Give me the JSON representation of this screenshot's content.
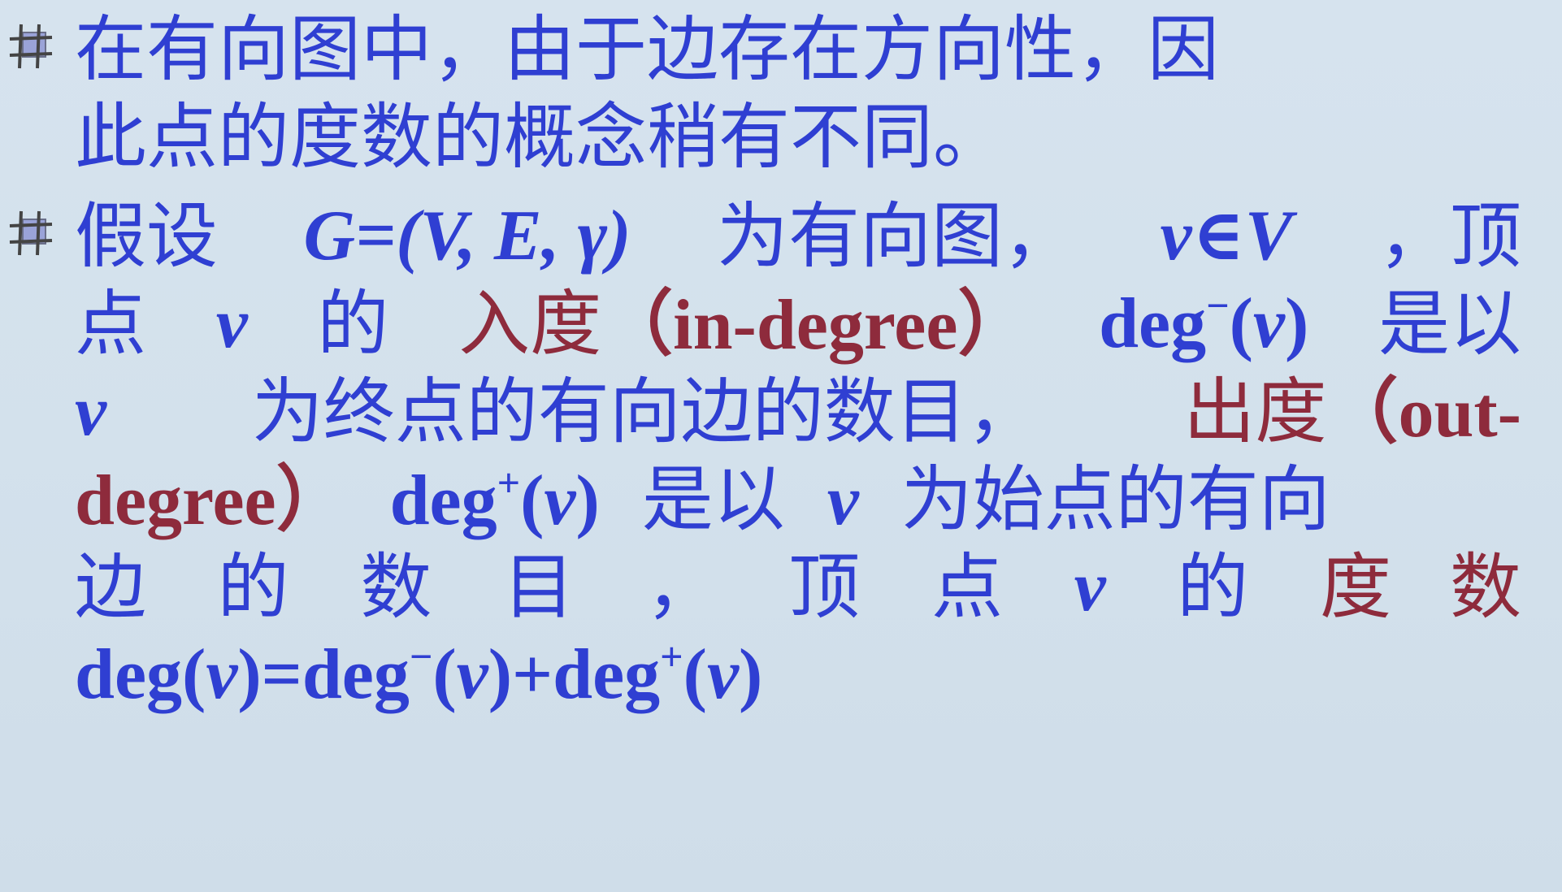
{
  "bullet_icon": "hash-square-bullet-icon",
  "colors": {
    "text": "#2f3fd2",
    "emphasis": "#8e2b3c",
    "background": "#d4e1ec"
  },
  "para1": {
    "line1": "在有向图中，由于边存在方向性，因",
    "line2": "此点的度数的概念稍有不同。"
  },
  "para2": {
    "l1_a": "假设",
    "l1_b": "G=(V, E, γ)",
    "l1_c": "为有向图，",
    "l1_d": "v∈V",
    "l1_e": "，顶",
    "l2_a": "点",
    "l2_b": "v",
    "l2_c": "的",
    "l2_d": "入度",
    "l2_e": "（in-degree）",
    "l2_f": "deg",
    "l2_g": "−",
    "l2_h": "(",
    "l2_i": "v",
    "l2_j": ")",
    "l2_k": "是以",
    "l3_a": "v",
    "l3_b": "为终点的有向边的数目，",
    "l3_c": "出度",
    "l3_d": "（out-",
    "l4_a": "degree）",
    "l4_b": "deg",
    "l4_c": "+",
    "l4_d": "(",
    "l4_e": "v",
    "l4_f": ")",
    "l4_g": "是以",
    "l4_h": "v",
    "l4_i": "为始点的有向",
    "l5_tokens": [
      "边",
      "的",
      "数",
      "目",
      "，",
      "顶",
      "点",
      "v",
      "的",
      "度",
      "数"
    ],
    "l6_a": "deg(",
    "l6_b": "v",
    "l6_c": ")=deg",
    "l6_d": "−",
    "l6_e": "(",
    "l6_f": "v",
    "l6_g": ")+deg",
    "l6_h": "+",
    "l6_i": "(",
    "l6_j": "v",
    "l6_k": ")"
  }
}
